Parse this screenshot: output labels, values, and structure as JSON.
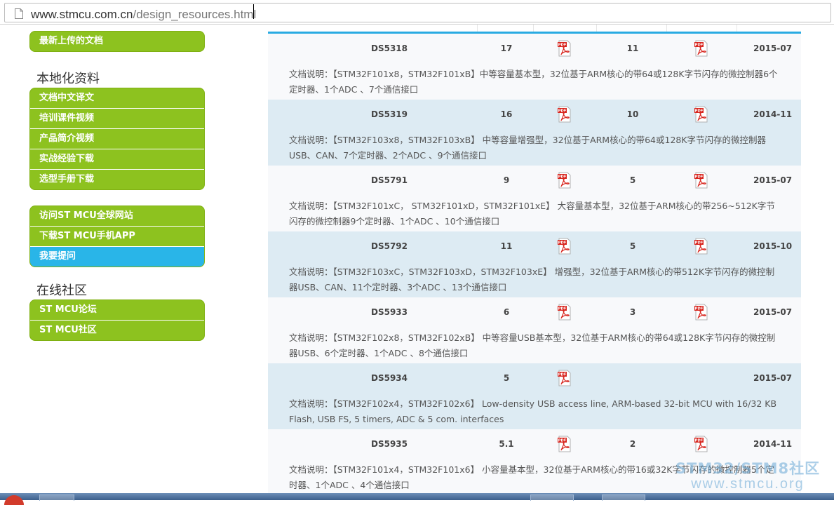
{
  "browser": {
    "url_host": "www.stmcu.com.cn",
    "url_path": "/design_resources.html"
  },
  "sidebar": {
    "top_menu": [
      "最新上传的文档"
    ],
    "local_title": "本地化资料",
    "local_menu": [
      "文档中文译文",
      "培训课件视频",
      "产品简介视频",
      "实战经验下载",
      "选型手册下载"
    ],
    "links_menu": [
      "访问ST MCU全球网站",
      "下载ST MCU手机APP",
      "我要提问"
    ],
    "links_active_index": 2,
    "community_title": "在线社区",
    "community_menu": [
      "ST MCU论坛",
      "ST MCU社区"
    ]
  },
  "table": {
    "accent_color": "#29abe2",
    "rows": [
      {
        "name": "DS5318",
        "en_pages": "17",
        "cn_pages": "11",
        "date": "2015-07",
        "has_cn_pdf": true,
        "desc": "文档说明：【STM32F101x8，STM32F101xB】中等容量基本型，32位基于ARM核心的带64或128K字节闪存的微控制器6个定时器、1个ADC 、7个通信接口"
      },
      {
        "name": "DS5319",
        "en_pages": "16",
        "cn_pages": "10",
        "date": "2014-11",
        "has_cn_pdf": true,
        "desc": "文档说明：【STM32F103x8，STM32F103xB】 中等容量增强型，32位基于ARM核心的带64或128K字节闪存的微控制器USB、CAN、7个定时器、2个ADC 、9个通信接口"
      },
      {
        "name": "DS5791",
        "en_pages": "9",
        "cn_pages": "5",
        "date": "2015-07",
        "has_cn_pdf": true,
        "desc": "文档说明：【STM32F101xC， STM32F101xD，STM32F101xE】 大容量基本型，32位基于ARM核心的带256~512K字节闪存的微控制器9个定时器、1个ADC 、10个通信接口"
      },
      {
        "name": "DS5792",
        "en_pages": "11",
        "cn_pages": "5",
        "date": "2015-10",
        "has_cn_pdf": true,
        "desc": "文档说明：【STM32F103xC，STM32F103xD，STM32F103xE】 增强型，32位基于ARM核心的带512K字节闪存的微控制器USB、CAN、11个定时器、3个ADC 、13个通信接口"
      },
      {
        "name": "DS5933",
        "en_pages": "6",
        "cn_pages": "3",
        "date": "2015-07",
        "has_cn_pdf": true,
        "desc": "文档说明：【STM32F102x8，STM32F102xB】 中等容量USB基本型，32位基于ARM核心的带64或128K字节闪存的微控制器USB、6个定时器、1个ADC 、8个通信接口"
      },
      {
        "name": "DS5934",
        "en_pages": "5",
        "cn_pages": "",
        "date": "2015-07",
        "has_cn_pdf": false,
        "desc": "文档说明：【STM32F102x4，STM32F102x6】 Low-density USB access line, ARM-based 32-bit MCU with 16/32 KB Flash, USB FS, 5 timers, ADC & 5 com. interfaces"
      },
      {
        "name": "DS5935",
        "en_pages": "5.1",
        "cn_pages": "2",
        "date": "2014-11",
        "has_cn_pdf": true,
        "desc": "文档说明：【STM32F101x4，STM32F101x6】 小容量基本型，32位基于ARM核心的带16或32K字节闪存的微控制器5个定时器、1个ADC 、4个通信接口"
      }
    ]
  },
  "watermark": {
    "line1": "STM32/STM8社区",
    "line2": "www.stmcu.org"
  },
  "icons": {
    "pdf": "pdf-file-icon",
    "page": "page-icon"
  }
}
